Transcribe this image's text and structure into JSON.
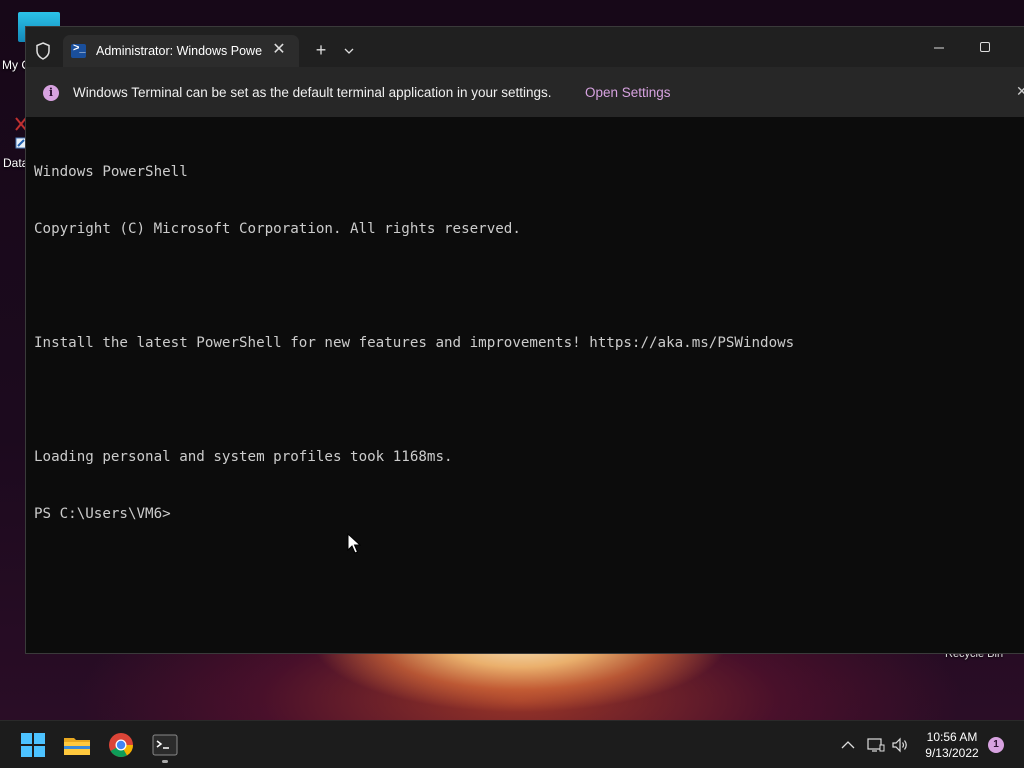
{
  "desktop": {
    "icons": [
      {
        "label": "My C"
      },
      {
        "label": "Data"
      }
    ],
    "recycle_bin_label": "Recycle Bin"
  },
  "terminal": {
    "tab_title": "Administrator: Windows PowerShell",
    "new_tab_glyph": "+",
    "close_glyph": "✕",
    "minimize_glyph": "—",
    "maximize_glyph": "☐",
    "infobar": {
      "icon_glyph": "i",
      "message": "Windows Terminal can be set as the default terminal application in your settings.",
      "link": "Open Settings",
      "close_glyph": "✕"
    },
    "console_lines": [
      "Windows PowerShell",
      "Copyright (C) Microsoft Corporation. All rights reserved.",
      "",
      "Install the latest PowerShell for new features and improvements! https://aka.ms/PSWindows",
      "",
      "Loading personal and system profiles took 1168ms.",
      "PS C:\\Users\\VM6>"
    ]
  },
  "taskbar": {
    "apps": [
      "start-icon",
      "file-explorer-icon",
      "chrome-icon",
      "terminal-icon"
    ],
    "clock_time": "10:56 AM",
    "clock_date": "9/13/2022",
    "notification_count": "1"
  },
  "colors": {
    "accent": "#d7a2e0",
    "terminal_bg": "#0c0c0c",
    "titlebar_bg": "#202020",
    "infobar_bg": "#272727",
    "console_text": "#cccccc"
  }
}
